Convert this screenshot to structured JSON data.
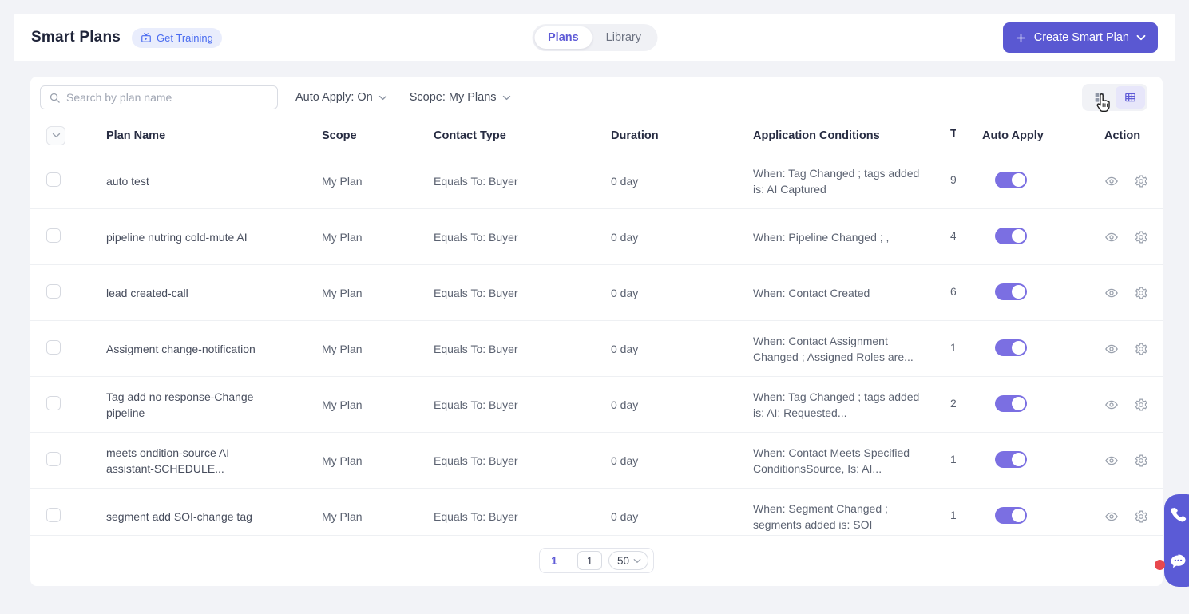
{
  "header": {
    "title": "Smart Plans",
    "training_badge": {
      "label": "Get Training"
    },
    "tabs": [
      {
        "label": "Plans",
        "active": true
      },
      {
        "label": "Library",
        "active": false
      }
    ],
    "create_button": {
      "label": "Create Smart Plan"
    }
  },
  "toolbar": {
    "search_placeholder": "Search by plan name",
    "auto_apply_filter": "Auto Apply: On",
    "scope_filter": "Scope: My Plans"
  },
  "table": {
    "headers": {
      "plan_name": "Plan Name",
      "scope": "Scope",
      "contact_type": "Contact Type",
      "duration": "Duration",
      "application_conditions": "Application Conditions",
      "truncated_column": "T",
      "auto_apply": "Auto Apply",
      "action": "Action"
    },
    "rows": [
      {
        "name": "auto test",
        "scope": "My Plan",
        "contact_type": "Equals To: Buyer",
        "duration": "0 day",
        "conditions": "When: Tag Changed ; tags added is: AI Captured",
        "count": "9",
        "auto_apply": true
      },
      {
        "name": "pipeline nutring cold-mute AI",
        "scope": "My Plan",
        "contact_type": "Equals To: Buyer",
        "duration": "0 day",
        "conditions": "When: Pipeline Changed ; ,",
        "count": "4",
        "auto_apply": true
      },
      {
        "name": "lead created-call",
        "scope": "My Plan",
        "contact_type": "Equals To: Buyer",
        "duration": "0 day",
        "conditions": "When: Contact Created",
        "count": "6",
        "auto_apply": true
      },
      {
        "name": "Assigment change-notification",
        "scope": "My Plan",
        "contact_type": "Equals To: Buyer",
        "duration": "0 day",
        "conditions": "When: Contact Assignment Changed ; Assigned Roles are...",
        "count": "1",
        "auto_apply": true
      },
      {
        "name": "Tag add no response-Change pipeline",
        "scope": "My Plan",
        "contact_type": "Equals To: Buyer",
        "duration": "0 day",
        "conditions": "When: Tag Changed ; tags added is: AI: Requested...",
        "count": "2",
        "auto_apply": true
      },
      {
        "name": "meets ondition-source AI assistant-SCHEDULE...",
        "scope": "My Plan",
        "contact_type": "Equals To: Buyer",
        "duration": "0 day",
        "conditions": "When: Contact Meets Specified ConditionsSource, Is: AI...",
        "count": "1",
        "auto_apply": true
      },
      {
        "name": "segment add SOI-change tag",
        "scope": "My Plan",
        "contact_type": "Equals To: Buyer",
        "duration": "0 day",
        "conditions": "When: Segment Changed ; segments added is: SOI",
        "count": "1",
        "auto_apply": true
      }
    ]
  },
  "pagination": {
    "current_page": "1",
    "page_input": "1",
    "page_size": "50"
  },
  "colors": {
    "page_bg": "#f2f3f7",
    "accent_button": "#5a58d2",
    "toggle_on": "#7b6fe2",
    "active_tab_text": "#5f5bd7",
    "badge_bg": "#e9edfc",
    "badge_text": "#4a6cf0",
    "floating_widget": "#5b5bd6",
    "notification_dot": "#e8484d"
  },
  "icons": {
    "search": "magnifier",
    "training_video": "tv",
    "plus": "+",
    "chevron_down": "v",
    "grid_view": "2x2-squares",
    "table_view": "table-grid",
    "eye": "view",
    "gear": "settings",
    "phone": "call",
    "chat": "speech-bubble-dots",
    "cursor": "pointing-hand"
  }
}
